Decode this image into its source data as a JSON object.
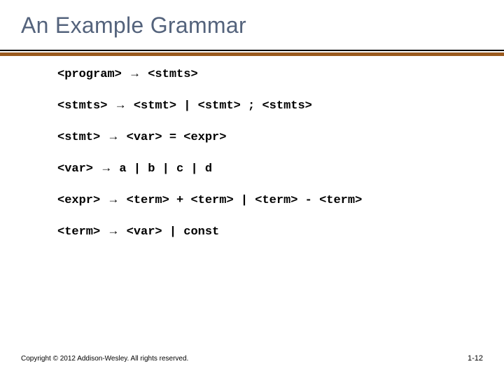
{
  "title": "An Example Grammar",
  "arrow": "→",
  "grammar": [
    {
      "lhs": "<program>",
      "rhs": "<stmts>"
    },
    {
      "lhs": "<stmts>",
      "rhs": "<stmt> | <stmt> ; <stmts>"
    },
    {
      "lhs": "<stmt>",
      "rhs": "<var> = <expr>"
    },
    {
      "lhs": "<var>",
      "rhs": "a | b | c | d"
    },
    {
      "lhs": "<expr>",
      "rhs": "<term> + <term> | <term> - <term>"
    },
    {
      "lhs": "<term>",
      "rhs": "<var> | const"
    }
  ],
  "footer": {
    "copyright": "Copyright © 2012 Addison-Wesley. All rights reserved.",
    "pagenum": "1-12"
  }
}
